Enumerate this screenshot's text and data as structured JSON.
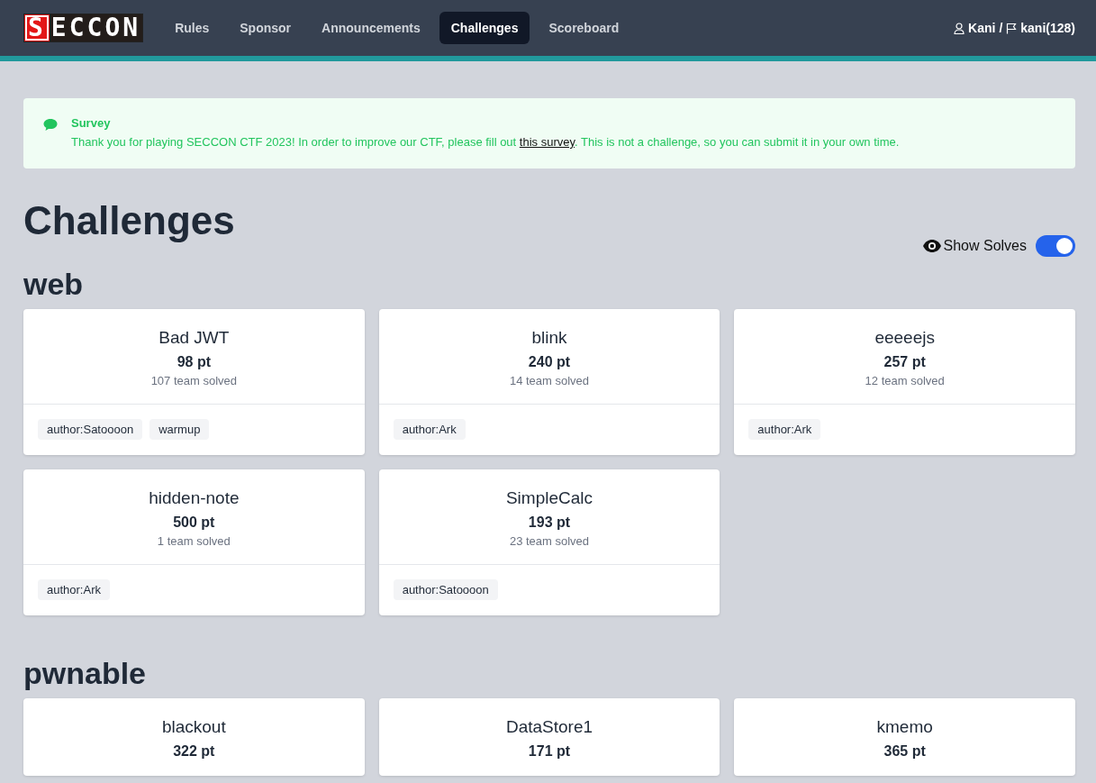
{
  "nav": {
    "logo": [
      "S",
      "ECCON"
    ],
    "links": [
      {
        "label": "Rules",
        "selected": false
      },
      {
        "label": "Sponsor",
        "selected": false
      },
      {
        "label": "Announcements",
        "selected": false
      },
      {
        "label": "Challenges",
        "selected": true
      },
      {
        "label": "Scoreboard",
        "selected": false
      }
    ],
    "user": "Kani",
    "separator": "/",
    "team": "kani(128)"
  },
  "alert": {
    "title": "Survey",
    "text_before": "Thank you for playing SECCON CTF 2023! In order to improve our CTF, please fill out",
    "link": "this survey",
    "text_after": ". This is not a challenge, so you can submit it in your own time."
  },
  "title": "Challenges",
  "show_solves": {
    "label": "Show Solves",
    "on": true
  },
  "categories": [
    {
      "name": "web",
      "challenges": [
        {
          "name": "Bad JWT",
          "points": "98 pt",
          "solved": "107 team solved",
          "tags": [
            "author:Satoooon",
            "warmup"
          ]
        },
        {
          "name": "blink",
          "points": "240 pt",
          "solved": "14 team solved",
          "tags": [
            "author:Ark"
          ]
        },
        {
          "name": "eeeeejs",
          "points": "257 pt",
          "solved": "12 team solved",
          "tags": [
            "author:Ark"
          ]
        },
        {
          "name": "hidden-note",
          "points": "500 pt",
          "solved": "1 team solved",
          "tags": [
            "author:Ark"
          ]
        },
        {
          "name": "SimpleCalc",
          "points": "193 pt",
          "solved": "23 team solved",
          "tags": [
            "author:Satoooon"
          ]
        }
      ]
    },
    {
      "name": "pwnable",
      "challenges": [
        {
          "name": "blackout",
          "points": "322 pt"
        },
        {
          "name": "DataStore1",
          "points": "171 pt"
        },
        {
          "name": "kmemo",
          "points": "365 pt"
        }
      ]
    }
  ]
}
